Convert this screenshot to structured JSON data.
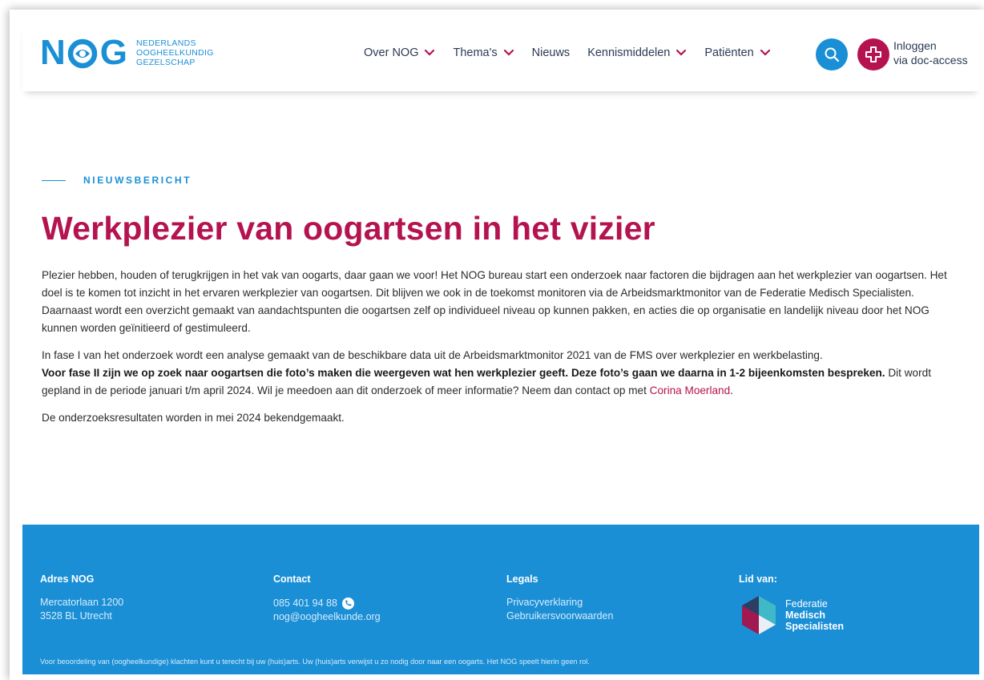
{
  "header": {
    "logo": {
      "mark_n": "N",
      "mark_g": "G",
      "line1": "NEDERLANDS",
      "line2": "OOGHEELKUNDIG",
      "line3": "GEZELSCHAP"
    },
    "nav": [
      {
        "label": "Over NOG",
        "has_dropdown": true
      },
      {
        "label": "Thema's",
        "has_dropdown": true
      },
      {
        "label": "Nieuws",
        "has_dropdown": false
      },
      {
        "label": "Kennismiddelen",
        "has_dropdown": true
      },
      {
        "label": "Patiënten",
        "has_dropdown": true
      }
    ],
    "search_icon": "search-icon",
    "login": {
      "line1": "Inloggen",
      "line2": "via doc-access",
      "icon": "medical-cross-icon"
    }
  },
  "article": {
    "kicker": "NIEUWSBERICHT",
    "title": "Werkplezier van oogartsen in het vizier",
    "p1": "Plezier hebben, houden of terugkrijgen in het vak van oogarts, daar gaan we voor! Het NOG bureau start een onderzoek naar factoren die bijdragen aan het werkplezier van oogartsen. Het doel is te komen tot inzicht in het ervaren werkplezier van oogartsen. Dit blijven we ook in de toekomst monitoren via de Arbeidsmarktmonitor van de Federatie Medisch Specialisten. Daarnaast wordt een overzicht gemaakt van aandachtspunten die oogartsen zelf op individueel niveau op kunnen pakken, en acties die op organisatie en landelijk niveau door het NOG kunnen worden geïnitieerd of gestimuleerd.",
    "p2_intro": "In fase I van het onderzoek wordt een analyse gemaakt van de beschikbare data uit de Arbeidsmarktmonitor 2021 van de FMS over werkplezier en werkbelasting.",
    "p2_bold": "Voor fase II zijn we op zoek naar oogartsen die foto’s maken die weergeven wat hen werkplezier geeft. Deze foto’s gaan we daarna in 1-2 bijeenkomsten bespreken.",
    "p2_rest": " Dit wordt gepland in de periode januari t/m april 2024. Wil je meedoen aan dit onderzoek of meer informatie? Neem dan contact op met ",
    "p2_link": "Corina Moerland",
    "p2_end": ".",
    "p3": "De onderzoeksresultaten worden in mei 2024 bekendgemaakt."
  },
  "footer": {
    "address": {
      "heading": "Adres NOG",
      "line1": "Mercatorlaan 1200",
      "line2": "3528 BL Utrecht"
    },
    "contact": {
      "heading": "Contact",
      "phone": "085 401 94 88",
      "email": "nog@oogheelkunde.org",
      "phone_icon": "phone-icon"
    },
    "legals": {
      "heading": "Legals",
      "privacy": "Privacyverklaring",
      "terms": "Gebruikersvoorwaarden"
    },
    "member": {
      "heading": "Lid van:",
      "line1": "Federatie",
      "line2": "Medisch",
      "line3": "Specialisten"
    },
    "disclaimer": "Voor beoordeling van (oogheelkundige) klachten kunt u terecht bij uw (huis)arts. Uw (huis)arts verwijst u zo nodig door naar een oogarts. Het NOG speelt hierin geen rol."
  },
  "colors": {
    "brand_blue": "#1a8fd6",
    "brand_magenta": "#b5134f",
    "nav_text": "#2b3a55"
  }
}
